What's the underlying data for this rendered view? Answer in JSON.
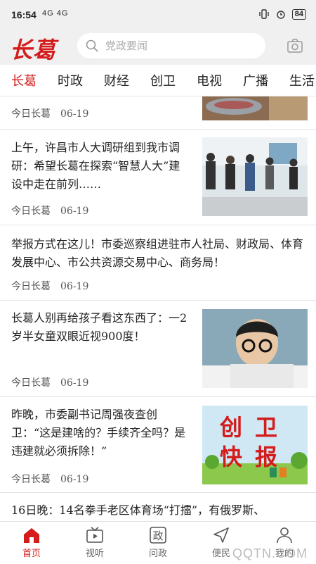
{
  "status": {
    "time": "16:54",
    "signal": "4G 4G",
    "battery": "84"
  },
  "header": {
    "logo": "长葛",
    "search_placeholder": "党政要闻"
  },
  "tabs": [
    "长葛",
    "时政",
    "财经",
    "创卫",
    "电视",
    "广播",
    "生活"
  ],
  "news": [
    {
      "title": "",
      "source": "今日长葛",
      "date": "06-19",
      "thumb": "food"
    },
    {
      "title": "上午，许昌市人大调研组到我市调研：希望长葛在探索“智慧人大”建设中走在前列……",
      "source": "今日长葛",
      "date": "06-19",
      "thumb": "meeting"
    },
    {
      "title": "举报方式在这儿！市委巡察组进驻市人社局、财政局、体育发展中心、市公共资源交易中心、商务局！",
      "source": "今日长葛",
      "date": "06-19",
      "thumb": ""
    },
    {
      "title": "长葛人别再给孩子看这东西了：一2岁半女童双眼近视900度！",
      "source": "今日长葛",
      "date": "06-19",
      "thumb": "child"
    },
    {
      "title": "昨晚，市委副书记周强夜查创卫：“这是建啥的？手续齐全吗？是违建就必须拆除！”",
      "source": "今日长葛",
      "date": "06-19",
      "thumb": "chuangwei",
      "thumb_text": "创卫快报"
    },
    {
      "title": "16日晚：14名拳手老区体育场“打擂”，有俄罗斯、",
      "source": "",
      "date": "",
      "thumb": ""
    }
  ],
  "tabbar": [
    {
      "label": "首页",
      "icon": "home-icon",
      "active": true
    },
    {
      "label": "视听",
      "icon": "tv-icon",
      "active": false
    },
    {
      "label": "问政",
      "icon": "zheng-icon",
      "glyph": "政",
      "active": false
    },
    {
      "label": "便民",
      "icon": "send-icon",
      "active": false
    },
    {
      "label": "我的",
      "icon": "user-icon",
      "active": false
    }
  ],
  "watermark": "QQTN.COM",
  "colors": {
    "accent": "#d41c1c",
    "header_bg": "#f0f0f0"
  }
}
